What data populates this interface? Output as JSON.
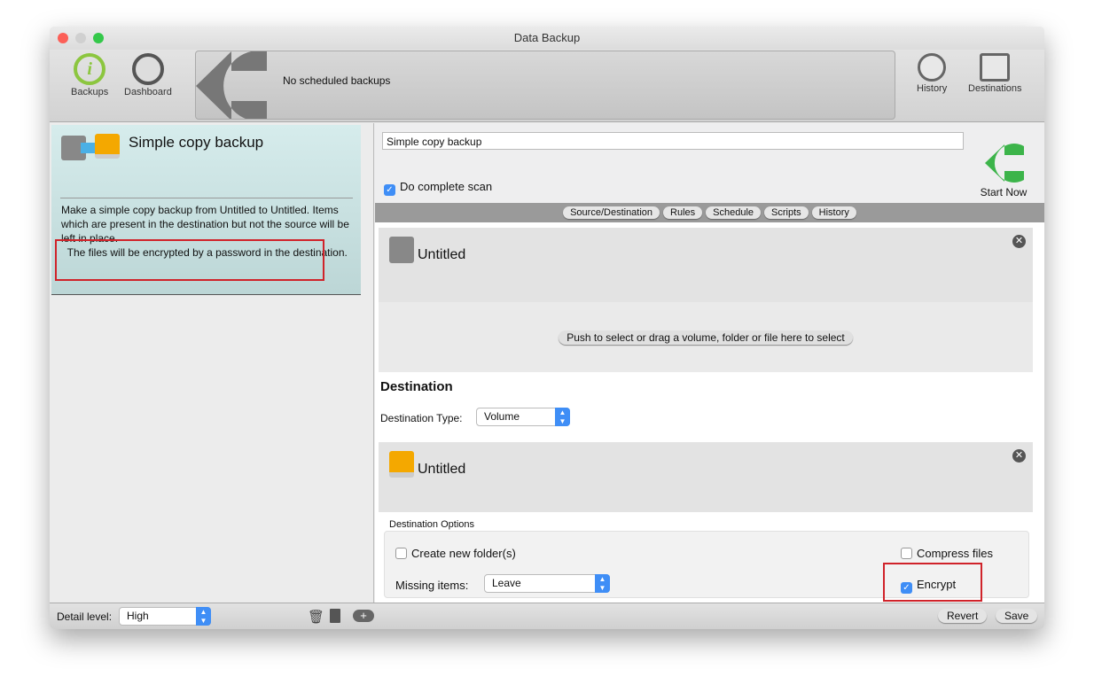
{
  "window": {
    "title": "Data Backup"
  },
  "toolbar": {
    "backups": "Backups",
    "dashboard": "Dashboard",
    "banner": "No scheduled backups",
    "history": "History",
    "destinations": "Destinations"
  },
  "card": {
    "title": "Simple copy backup",
    "desc": "Make a simple copy backup from Untitled to Untitled. Items which are present in the destination but not the source will be left in place.",
    "encrypt_note": "  The files will be encrypted by a password in the destination."
  },
  "main": {
    "name_value": "Simple copy backup",
    "complete_scan": "Do complete scan",
    "start_now": "Start Now",
    "tabs": [
      "Source/Destination",
      "Rules",
      "Schedule",
      "Scripts",
      "History"
    ],
    "source": {
      "name": "Untitled",
      "push": "Push to select or drag a volume, folder or file here to select"
    },
    "destination": {
      "heading": "Destination",
      "type_label": "Destination Type:",
      "type_value": "Volume",
      "name": "Untitled"
    },
    "options": {
      "heading": "Destination Options",
      "create_folder": "Create new folder(s)",
      "compress": "Compress files",
      "missing_label": "Missing items:",
      "missing_value": "Leave",
      "encrypt": "Encrypt",
      "create_folder_checked": false,
      "compress_checked": false,
      "encrypt_checked": true
    }
  },
  "bottom": {
    "detail_label": "Detail level:",
    "detail_value": "High",
    "revert": "Revert",
    "save": "Save"
  },
  "colors": {
    "accent": "#3f8ef6",
    "highlight": "#d0232a",
    "start_green": "#3cb44a"
  }
}
